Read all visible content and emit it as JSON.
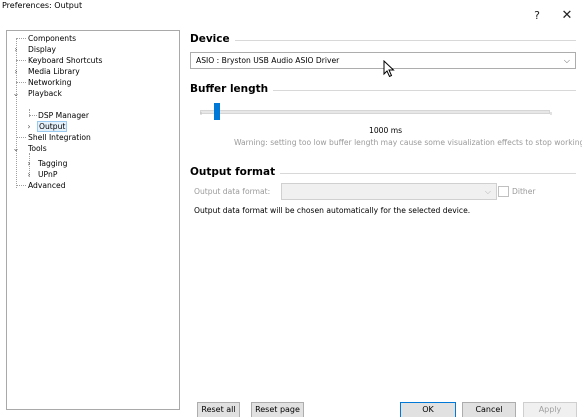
{
  "window": {
    "title": "Preferences: Output",
    "help_label": "?",
    "close_label": "✕"
  },
  "tree": {
    "items": [
      {
        "label": "Components"
      },
      {
        "label": "Display"
      },
      {
        "label": "Keyboard Shortcuts"
      },
      {
        "label": "Media Library"
      },
      {
        "label": "Networking"
      },
      {
        "label": "Playback"
      },
      {
        "label": "DSP Manager"
      },
      {
        "label": "Output"
      },
      {
        "label": "Shell Integration"
      },
      {
        "label": "Tools"
      },
      {
        "label": "Tagging"
      },
      {
        "label": "UPnP"
      },
      {
        "label": "Advanced"
      }
    ],
    "selected": "Output"
  },
  "device": {
    "title": "Device",
    "selected": "ASIO : Bryston USB Audio ASIO Driver"
  },
  "buffer": {
    "title": "Buffer length",
    "value_label": "1000 ms",
    "warning": "Warning: setting too low buffer length may cause some visualization effects to stop working.",
    "fraction": 0.04
  },
  "output_format": {
    "title": "Output format",
    "format_label": "Output data format:",
    "format_value": "",
    "dither_label": "Dither",
    "dither_checked": false,
    "note": "Output data format will be chosen automatically for the selected device."
  },
  "buttons": {
    "reset_all": "Reset all",
    "reset_page": "Reset page",
    "ok": "OK",
    "cancel": "Cancel",
    "apply": "Apply"
  },
  "colors": {
    "accent": "#0078d7",
    "selection_bg": "#e5f1fb"
  }
}
